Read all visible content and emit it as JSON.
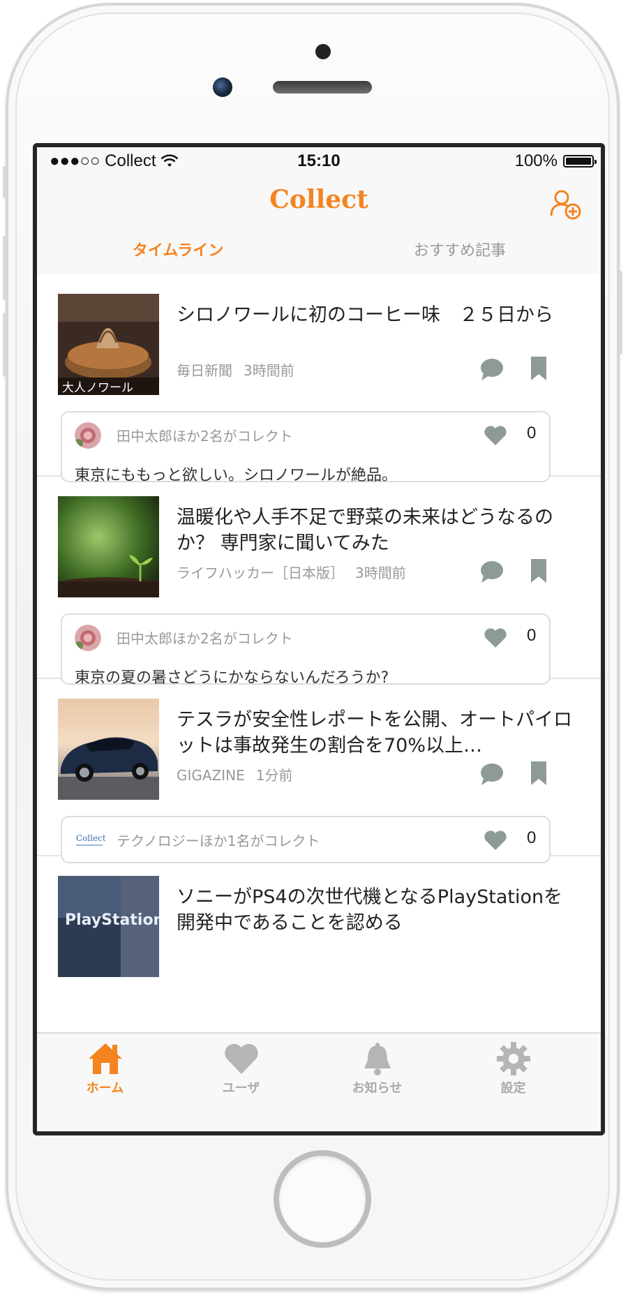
{
  "status_bar": {
    "carrier": "●●●○○ Collect",
    "time": "15:10",
    "battery": "100%"
  },
  "header": {
    "title": "Collect",
    "add_user_icon": "add-user-icon"
  },
  "tabs": [
    {
      "label": "タイムライン",
      "active": true
    },
    {
      "label": "おすすめ記事",
      "active": false
    }
  ],
  "colors": {
    "accent": "#f5831f",
    "icon_gray": "#8e9a98"
  },
  "posts": [
    {
      "title": "シロノワールに初のコーヒー味　２５日から",
      "source": "毎日新聞",
      "time": "3時間前",
      "collect_text": "田中太郎ほか2名がコレクト",
      "likes": "0",
      "comment": "東京にももっと欲しい。シロノワールが絶品。",
      "thumb_text": "大人ノワール"
    },
    {
      "title": "温暖化や人手不足で野菜の未来はどうなるのか？ 専門家に聞いてみた",
      "source": "ライフハッカー［日本版］",
      "time": "3時間前",
      "collect_text": "田中太郎ほか2名がコレクト",
      "likes": "0",
      "comment": "東京の夏の暑さどうにかならないんだろうか?"
    },
    {
      "title": "テスラが安全性レポートを公開、オートパイロットは事故発生の割合を70%以上…",
      "source": "GIGAZINE",
      "time": "1分前",
      "collect_text": "テクノロジーほか1名がコレクト",
      "likes": "0",
      "avatar_text": "Collect"
    },
    {
      "title": "ソニーがPS4の次世代機となるPlayStationを開発中であることを認める",
      "thumb_text": "PlayStation"
    }
  ],
  "tabbar": [
    {
      "label": "ホーム",
      "icon": "home-icon",
      "active": true
    },
    {
      "label": "ユーザ",
      "icon": "heart-icon",
      "active": false
    },
    {
      "label": "お知らせ",
      "icon": "bell-icon",
      "active": false
    },
    {
      "label": "設定",
      "icon": "gear-icon",
      "active": false
    }
  ]
}
